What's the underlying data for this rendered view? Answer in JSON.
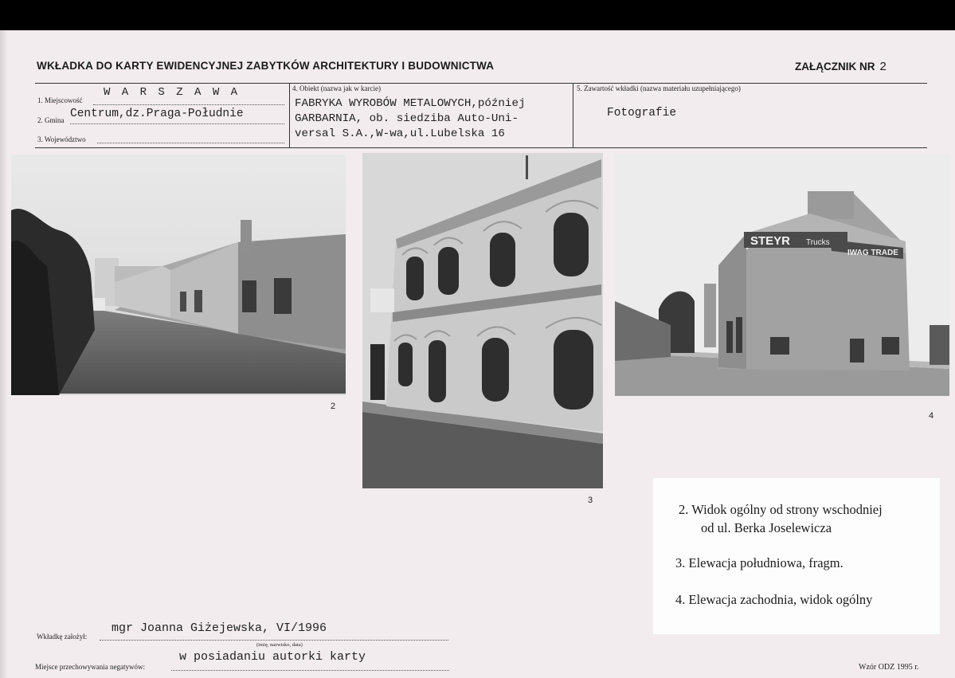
{
  "header": {
    "title": "WKŁADKA DO KARTY EWIDENCYJNEJ ZABYTKÓW ARCHITEKTURY I BUDOWNICTWA",
    "annex_label": "ZAŁĄCZNIK NR",
    "annex_number": "2"
  },
  "fields": {
    "miejscowosc": {
      "label": "1. Miejscowość",
      "value": "W A R S Z A W A"
    },
    "gmina": {
      "label": "2. Gmina",
      "value": "Centrum,dz.Praga-Południe"
    },
    "wojewodztwo": {
      "label": "3. Województwo",
      "value": ""
    },
    "obiekt": {
      "label": "4. Obiekt (nazwa jak w karcie)",
      "lines": [
        "FABRYKA WYROBÓW METALOWYCH,później",
        "GARBARNIA, ob. siedziba Auto-Uni-",
        "versal S.A.,W-wa,ul.Lubelska 16"
      ]
    },
    "zawartosc": {
      "label": "5. Zawartość wkładki (nazwa materiału uzupełniającego)",
      "value": "Fotografie"
    }
  },
  "photos": [
    {
      "number": "2"
    },
    {
      "number": "3"
    },
    {
      "number": "4",
      "sign_text_1": "STEYR",
      "sign_text_2": "Trucks",
      "sign_text_3": "IWAG TRADE"
    }
  ],
  "captions": [
    {
      "line1": "2. Widok ogólny od strony wschodniej",
      "line2": "od ul. Berka Joselewicza"
    },
    {
      "line1": "3.  Elewacja południowa, fragm."
    },
    {
      "line1": "4. Elewacja zachodnia, widok ogólny"
    }
  ],
  "footer": {
    "author_label": "Wkładkę założył:",
    "author_value": "mgr Joanna Giżejewska, VI/1996",
    "author_hint": "(imię, nazwisko, data)",
    "storage_label": "Miejsce przechowywania negatywów:",
    "storage_value": "w posiadaniu autorki karty",
    "form_id": "Wzór ODZ 1995 r."
  }
}
